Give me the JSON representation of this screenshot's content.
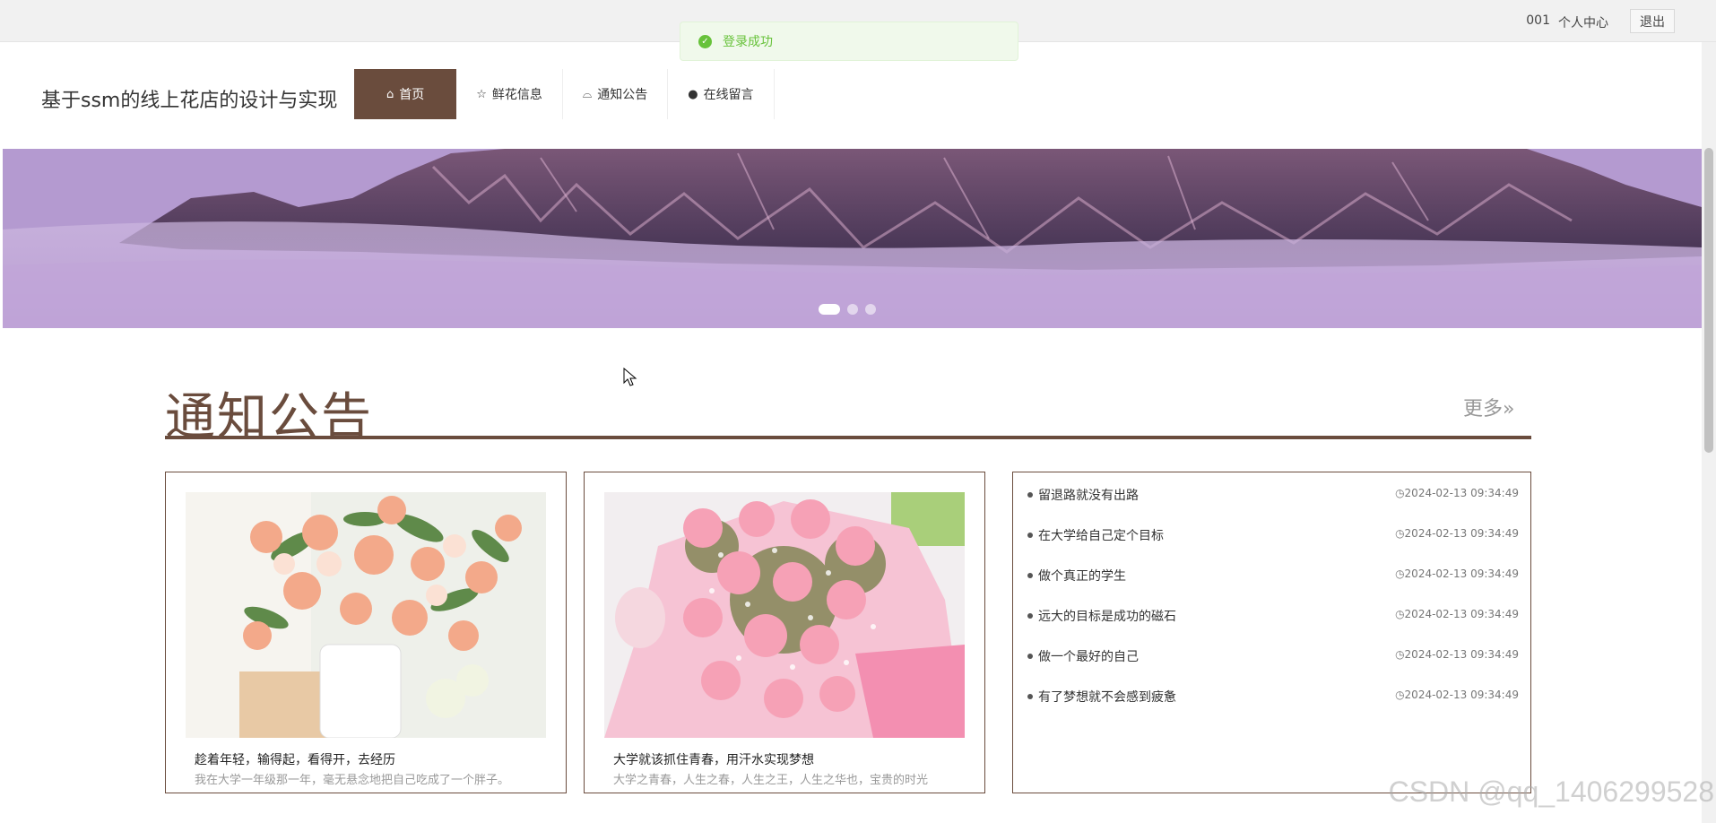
{
  "topbar": {
    "user_id": "001",
    "center_label": "个人中心",
    "logout_label": "退出"
  },
  "toast": {
    "message": "登录成功",
    "icon": "check-circle-icon",
    "color": "#67c23a"
  },
  "site": {
    "title": "基于ssm的线上花店的设计与实现"
  },
  "nav": {
    "items": [
      {
        "label": "首页",
        "icon": "home-icon",
        "active": true
      },
      {
        "label": "鲜花信息",
        "icon": "star-icon",
        "active": false
      },
      {
        "label": "通知公告",
        "icon": "bag-icon",
        "active": false
      },
      {
        "label": "在线留言",
        "icon": "exclamation-icon",
        "active": false
      }
    ]
  },
  "banner": {
    "slides": 3,
    "active_slide": 1
  },
  "notice_section": {
    "title": "通知公告",
    "more_label": "更多",
    "accent": "#6a4c3d",
    "cards": [
      {
        "title": "趁着年轻，输得起，看得开，去经历",
        "desc": "我在大学一年级那一年，毫无悬念地把自己吃成了一个胖子。"
      },
      {
        "title": "大学就该抓住青春，用汗水实现梦想",
        "desc": "大学之青春，人生之春，人生之王，人生之华也，宝贵的时光"
      }
    ],
    "list": [
      {
        "title": "留退路就没有出路",
        "date": "2024-02-13 09:34:49"
      },
      {
        "title": "在大学给自己定个目标",
        "date": "2024-02-13 09:34:49"
      },
      {
        "title": "做个真正的学生",
        "date": "2024-02-13 09:34:49"
      },
      {
        "title": "远大的目标是成功的磁石",
        "date": "2024-02-13 09:34:49"
      },
      {
        "title": "做一个最好的自己",
        "date": "2024-02-13 09:34:49"
      },
      {
        "title": "有了梦想就不会感到疲惫",
        "date": "2024-02-13 09:34:49"
      }
    ]
  },
  "watermark": "CSDN @qq_1406299528"
}
